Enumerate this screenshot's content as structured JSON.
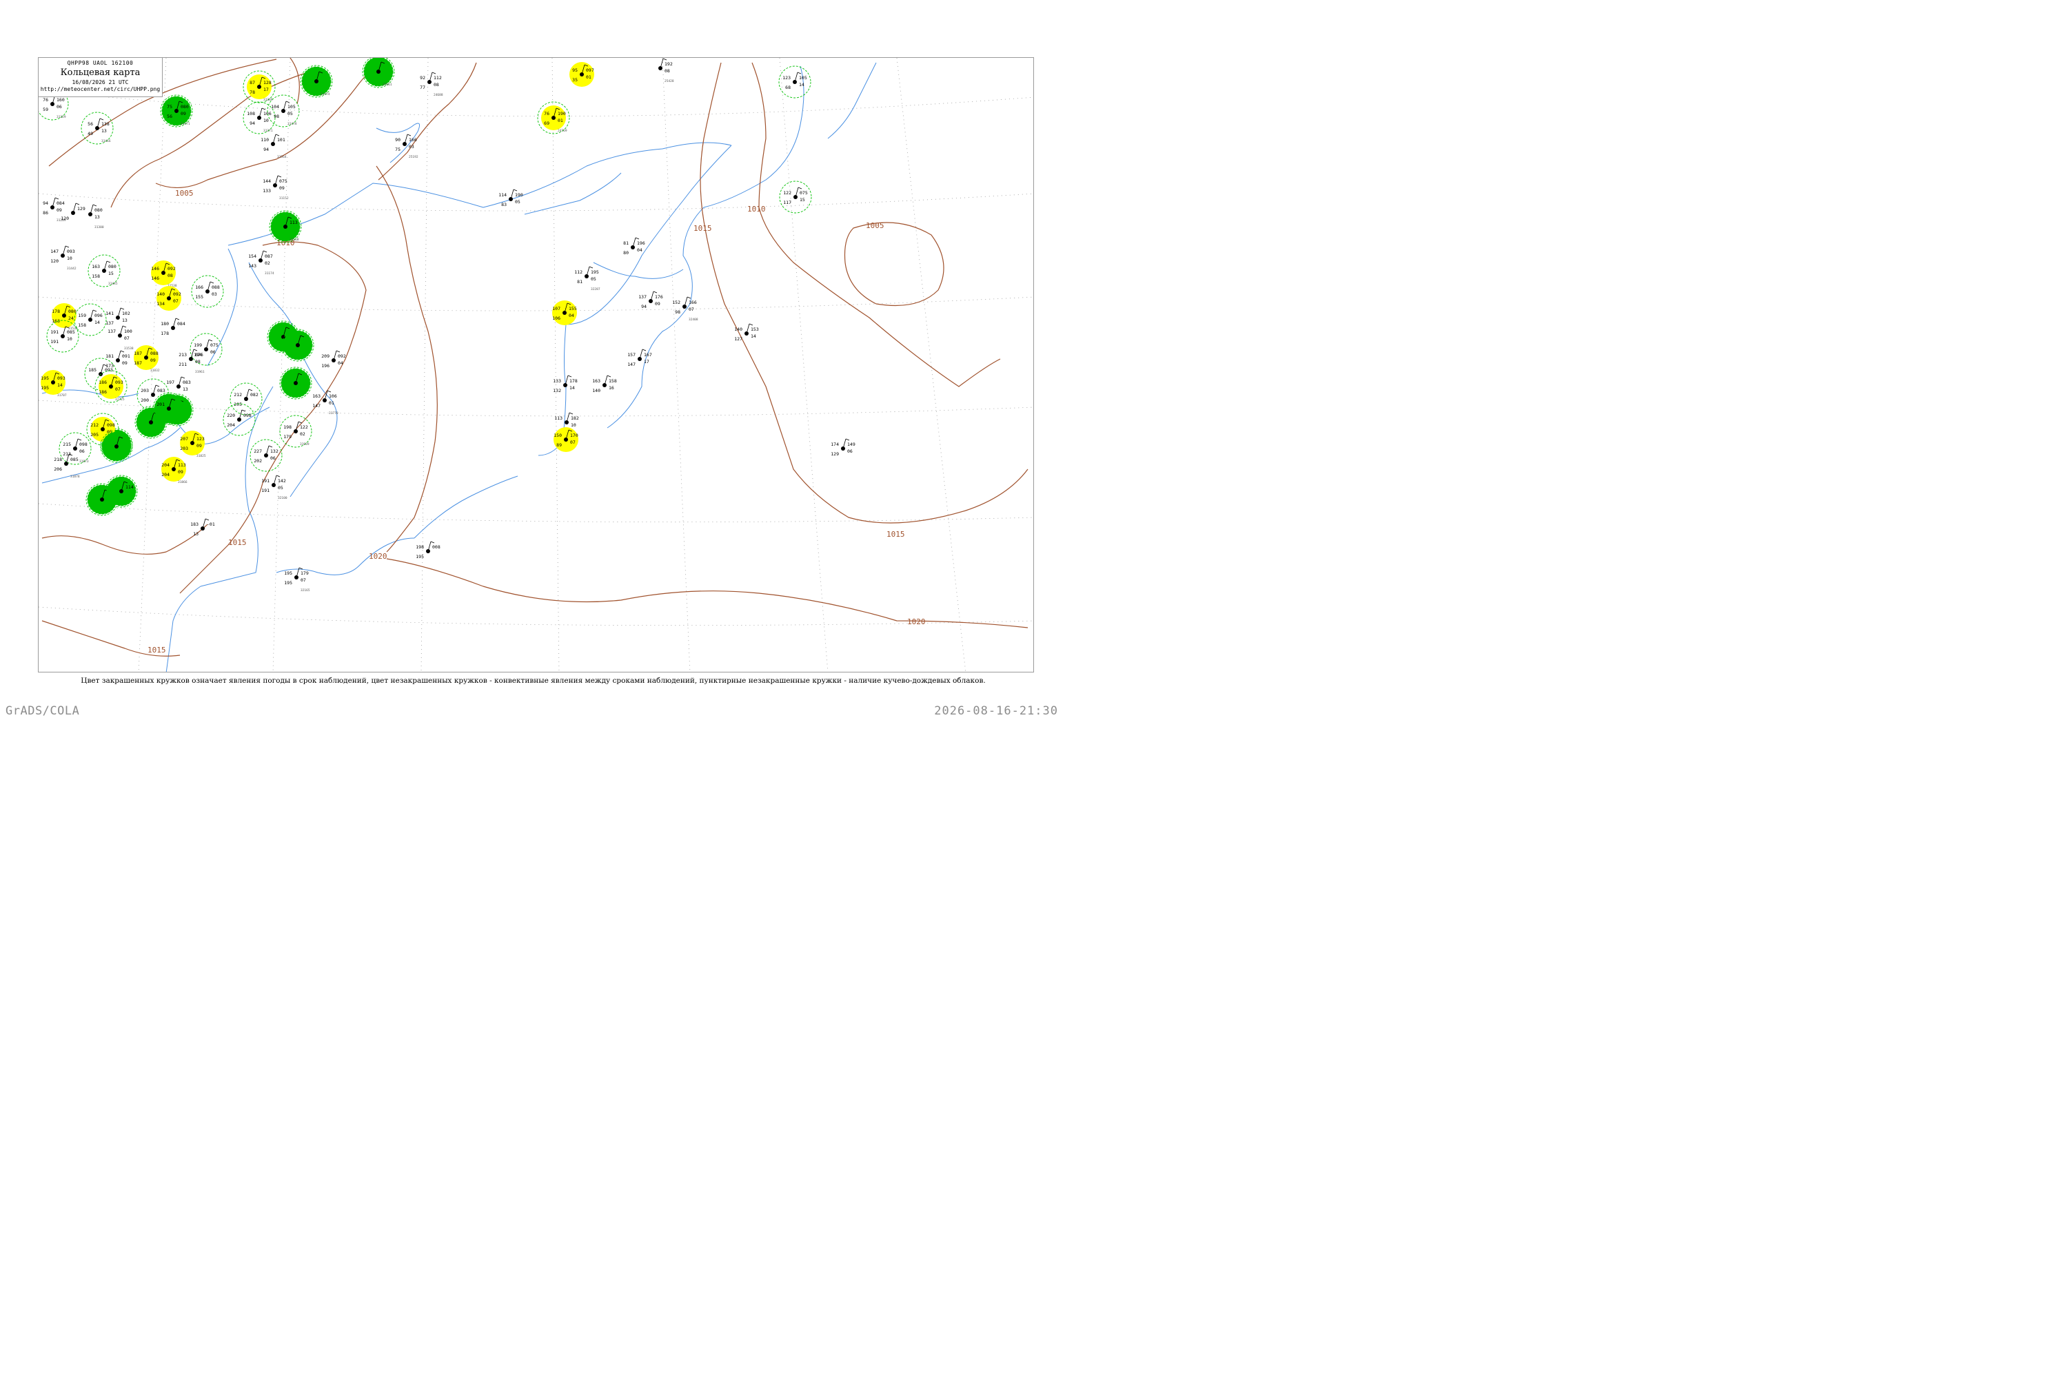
{
  "header": {
    "code_line": "QHPP98  UAOL  162100",
    "title": "Кольцевая карта",
    "datetime": "16/08/2026 21 UTC",
    "url": "http://meteocenter.net/circ/UHPP.png"
  },
  "footnote": "Цвет закрашенных кружков означает явления погоды в срок наблюдений, цвет незакрашенных кружков - конвективные явления между сроками наблюдений, пунктирные незакрашенные кружки - наличие кучево-дождевых облаков.",
  "credit": "GrADS/COLA",
  "timestamp": "2026-08-16-21:30",
  "colors": {
    "isobar": "#a0522d",
    "river": "#4a90e2",
    "shower_fill": "#00c000",
    "fog_fill": "#ffff00",
    "cb_ring": "#00c000",
    "grid": "#9a9a9a"
  },
  "isobar_labels": [
    "1005",
    "1010",
    "1010",
    "1015",
    "1015",
    "1005",
    "1015",
    "1015",
    "1020",
    "1020"
  ],
  "stations": [
    {
      "pressure": "160",
      "temp": "76",
      "dew": "59",
      "tend": "06",
      "id": "31329",
      "weather": "",
      "cb": true
    },
    {
      "pressure": "138",
      "temp": "56",
      "dew": "49",
      "tend": "13",
      "id": "31416",
      "weather": "",
      "cb": true
    },
    {
      "pressure": "128",
      "temp": "87",
      "dew": "78",
      "tend": "17",
      "id": "31369",
      "weather": "fog",
      "cb": true
    },
    {
      "pressure": "106",
      "temp": "108",
      "dew": "94",
      "tend": "10",
      "id": "31371",
      "weather": "",
      "cb": true
    },
    {
      "pressure": "105",
      "temp": "104",
      "dew": "98",
      "tend": "05",
      "id": "31478",
      "weather": "",
      "cb": true
    },
    {
      "pressure": "080",
      "temp": "75",
      "dew": "56",
      "tend": "09",
      "id": "31471",
      "weather": "shower",
      "cb": true
    },
    {
      "pressure": "",
      "temp": "",
      "dew": "",
      "tend": "",
      "id": "31474",
      "weather": "shower",
      "cb": true
    },
    {
      "pressure": "",
      "temp": "",
      "dew": "",
      "tend": "",
      "id": "32061",
      "weather": "shower",
      "cb": true
    },
    {
      "pressure": "112",
      "temp": "92",
      "dew": "77",
      "tend": "08",
      "id": "24688",
      "weather": "",
      "cb": false
    },
    {
      "pressure": "166",
      "temp": "90",
      "dew": "75",
      "tend": "03",
      "id": "25192",
      "weather": "",
      "cb": false
    },
    {
      "pressure": "101",
      "temp": "110",
      "dew": "94",
      "tend": "",
      "id": "31564",
      "weather": "",
      "cb": false
    },
    {
      "pressure": "075",
      "temp": "144",
      "dew": "133",
      "tend": "09",
      "id": "31152",
      "weather": "",
      "cb": false
    },
    {
      "pressure": "113",
      "temp": "",
      "dew": "",
      "tend": "",
      "id": "31168",
      "weather": "shower",
      "cb": true
    },
    {
      "pressure": "084",
      "temp": "94",
      "dew": "86",
      "tend": "09",
      "id": "31209",
      "weather": "",
      "cb": false
    },
    {
      "pressure": "129",
      "temp": "",
      "dew": "120",
      "tend": "",
      "id": "",
      "weather": "",
      "cb": false
    },
    {
      "pressure": "080",
      "temp": "",
      "dew": "",
      "tend": "13",
      "id": "31300",
      "weather": "",
      "cb": false
    },
    {
      "pressure": "093",
      "temp": "147",
      "dew": "120",
      "tend": "10",
      "id": "31442",
      "weather": "",
      "cb": false
    },
    {
      "pressure": "080",
      "temp": "163",
      "dew": "158",
      "tend": "15",
      "id": "31445",
      "weather": "",
      "cb": true
    },
    {
      "pressure": "092",
      "temp": "146",
      "dew": "146",
      "tend": "08",
      "id": "31538",
      "weather": "fog",
      "cb": false
    },
    {
      "pressure": "087",
      "temp": "154",
      "dew": "143",
      "tend": "02",
      "id": "31174",
      "weather": "",
      "cb": false
    },
    {
      "pressure": "088",
      "temp": "166",
      "dew": "155",
      "tend": "03",
      "id": "",
      "weather": "",
      "cb": true
    },
    {
      "pressure": "092",
      "temp": "140",
      "dew": "134",
      "tend": "07",
      "id": "",
      "weather": "fog",
      "cb": false
    },
    {
      "pressure": "080",
      "temp": "178",
      "dew": "163",
      "tend": "24",
      "id": "31532",
      "weather": "fog",
      "cb": false
    },
    {
      "pressure": "096",
      "temp": "159",
      "dew": "158",
      "tend": "14",
      "id": "",
      "weather": "",
      "cb": true
    },
    {
      "pressure": "102",
      "temp": "141",
      "dew": "137",
      "tend": "13",
      "id": "",
      "weather": "",
      "cb": false
    },
    {
      "pressure": "085",
      "temp": "191",
      "dew": "191",
      "tend": "10",
      "id": "",
      "weather": "",
      "cb": true
    },
    {
      "pressure": "100",
      "temp": "137",
      "dew": "",
      "tend": "07",
      "id": "31538",
      "weather": "",
      "cb": false
    },
    {
      "pressure": "084",
      "temp": "180",
      "dew": "178",
      "tend": "",
      "id": "",
      "weather": "",
      "cb": false
    },
    {
      "pressure": "075",
      "temp": "199",
      "dew": "194",
      "tend": "06",
      "id": "",
      "weather": "",
      "cb": true
    },
    {
      "pressure": "088",
      "temp": "187",
      "dew": "187",
      "tend": "09",
      "id": "31832",
      "weather": "fog",
      "cb": false
    },
    {
      "pressure": "091",
      "temp": "181",
      "dew": "173",
      "tend": "09",
      "id": "",
      "weather": "",
      "cb": false
    },
    {
      "pressure": "093",
      "temp": "185",
      "dew": "",
      "tend": "",
      "id": "",
      "weather": "",
      "cb": true
    },
    {
      "pressure": "093",
      "temp": "186",
      "dew": "186",
      "tend": "07",
      "id": "31725",
      "weather": "fog",
      "cb": true
    },
    {
      "pressure": "093",
      "temp": "195",
      "dew": "195",
      "tend": "14",
      "id": "31707",
      "weather": "fog",
      "cb": false
    },
    {
      "pressure": "083",
      "temp": "197",
      "dew": "",
      "tend": "13",
      "id": "",
      "weather": "",
      "cb": false
    },
    {
      "pressure": "083",
      "temp": "203",
      "dew": "200",
      "tend": "",
      "id": "",
      "weather": "",
      "cb": true
    },
    {
      "pressure": "076",
      "temp": "213",
      "dew": "211",
      "tend": "08",
      "id": "31961",
      "weather": "",
      "cb": false
    },
    {
      "pressure": "",
      "temp": "",
      "dew": "",
      "tend": "",
      "id": "",
      "weather": "shower",
      "cb": true
    },
    {
      "pressure": "",
      "temp": "",
      "dew": "",
      "tend": "",
      "id": "",
      "weather": "shower",
      "cb": true
    },
    {
      "pressure": "",
      "temp": "",
      "dew": "",
      "tend": "",
      "id": "",
      "weather": "shower",
      "cb": true
    },
    {
      "pressure": "092",
      "temp": "209",
      "dew": "196",
      "tend": "04",
      "id": "",
      "weather": "",
      "cb": false
    },
    {
      "pressure": "",
      "temp": "",
      "dew": "",
      "tend": "",
      "id": "",
      "weather": "shower",
      "cb": true
    },
    {
      "pressure": "106",
      "temp": "163",
      "dew": "147",
      "tend": "01",
      "id": "31770",
      "weather": "",
      "cb": false
    },
    {
      "pressure": "082",
      "temp": "212",
      "dew": "205",
      "tend": "",
      "id": "",
      "weather": "",
      "cb": true
    },
    {
      "pressure": "098",
      "temp": "220",
      "dew": "204",
      "tend": "",
      "id": "",
      "weather": "",
      "cb": true
    },
    {
      "pressure": "",
      "temp": "201",
      "dew": "",
      "tend": "",
      "id": "",
      "weather": "shower",
      "cb": true
    },
    {
      "pressure": "",
      "temp": "",
      "dew": "",
      "tend": "",
      "id": "",
      "weather": "shower",
      "cb": true
    },
    {
      "pressure": "122",
      "temp": "198",
      "dew": "179",
      "tend": "02",
      "id": "31939",
      "weather": "",
      "cb": true
    },
    {
      "pressure": "098",
      "temp": "212",
      "dew": "205",
      "tend": "05",
      "id": "",
      "weather": "fog",
      "cb": true
    },
    {
      "pressure": "",
      "temp": "",
      "dew": "",
      "tend": "",
      "id": "",
      "weather": "shower",
      "cb": true
    },
    {
      "pressure": "098",
      "temp": "215",
      "dew": "213",
      "tend": "06",
      "id": "31873",
      "weather": "",
      "cb": true
    },
    {
      "pressure": "123",
      "temp": "207",
      "dew": "203",
      "tend": "09",
      "id": "31825",
      "weather": "fog",
      "cb": false
    },
    {
      "pressure": "132",
      "temp": "227",
      "dew": "202",
      "tend": "06",
      "id": "",
      "weather": "",
      "cb": true
    },
    {
      "pressure": "085",
      "temp": "218",
      "dew": "206",
      "tend": "",
      "id": "31878",
      "weather": "",
      "cb": false
    },
    {
      "pressure": "113",
      "temp": "204",
      "dew": "204",
      "tend": "09",
      "id": "31866",
      "weather": "fog",
      "cb": false
    },
    {
      "pressure": "142",
      "temp": "191",
      "dew": "191",
      "tend": "05",
      "id": "32100",
      "weather": "",
      "cb": false
    },
    {
      "pressure": "",
      "temp": "",
      "dew": "",
      "tend": "",
      "id": "",
      "weather": "shower",
      "cb": true
    },
    {
      "pressure": "114",
      "temp": "",
      "dew": "",
      "tend": "",
      "id": "",
      "weather": "shower",
      "cb": true
    },
    {
      "pressure": "-01",
      "temp": "183",
      "dew": "13",
      "tend": "",
      "id": "",
      "weather": "",
      "cb": false
    },
    {
      "pressure": "008",
      "temp": "198",
      "dew": "195",
      "tend": "",
      "id": "",
      "weather": "",
      "cb": false
    },
    {
      "pressure": "179",
      "temp": "195",
      "dew": "195",
      "tend": "07",
      "id": "32165",
      "weather": "",
      "cb": false
    },
    {
      "pressure": "",
      "temp": "",
      "dew": "",
      "tend": "",
      "id": "",
      "weather": "shower",
      "cb": true
    },
    {
      "pressure": "097",
      "temp": "95",
      "dew": "35",
      "tend": "01",
      "id": "",
      "weather": "fog",
      "cb": false
    },
    {
      "pressure": "190",
      "temp": "76",
      "dew": "69",
      "tend": "01",
      "id": "24769",
      "weather": "fog",
      "cb": true
    },
    {
      "pressure": "192",
      "temp": "",
      "dew": "",
      "tend": "08",
      "id": "25428",
      "weather": "",
      "cb": false
    },
    {
      "pressure": "105",
      "temp": "123",
      "dew": "68",
      "tend": "14",
      "id": "",
      "weather": "",
      "cb": true
    },
    {
      "pressure": "190",
      "temp": "114",
      "dew": "83",
      "tend": "05",
      "id": "",
      "weather": "",
      "cb": false
    },
    {
      "pressure": "075",
      "temp": "122",
      "dew": "117",
      "tend": "15",
      "id": "",
      "weather": "",
      "cb": true
    },
    {
      "pressure": "196",
      "temp": "81",
      "dew": "80",
      "tend": "04",
      "id": "",
      "weather": "",
      "cb": false
    },
    {
      "pressure": "195",
      "temp": "112",
      "dew": "81",
      "tend": "05",
      "id": "32287",
      "weather": "",
      "cb": false
    },
    {
      "pressure": "176",
      "temp": "137",
      "dew": "94",
      "tend": "09",
      "id": "",
      "weather": "",
      "cb": false
    },
    {
      "pressure": "166",
      "temp": "152",
      "dew": "98",
      "tend": "07",
      "id": "32408",
      "weather": "",
      "cb": false
    },
    {
      "pressure": "155",
      "temp": "107",
      "dew": "106",
      "tend": "04",
      "id": "",
      "weather": "fog",
      "cb": false
    },
    {
      "pressure": "153",
      "temp": "140",
      "dew": "127",
      "tend": "14",
      "id": "",
      "weather": "",
      "cb": false
    },
    {
      "pressure": "167",
      "temp": "157",
      "dew": "147",
      "tend": "17",
      "id": "",
      "weather": "",
      "cb": false
    },
    {
      "pressure": "178",
      "temp": "133",
      "dew": "132",
      "tend": "14",
      "id": "",
      "weather": "",
      "cb": false
    },
    {
      "pressure": "158",
      "temp": "163",
      "dew": "140",
      "tend": "16",
      "id": "",
      "weather": "",
      "cb": false
    },
    {
      "pressure": "182",
      "temp": "113",
      "dew": "",
      "tend": "10",
      "id": "",
      "weather": "",
      "cb": false
    },
    {
      "pressure": "170",
      "temp": "150",
      "dew": "89",
      "tend": "07",
      "id": "",
      "weather": "fog",
      "cb": false
    },
    {
      "pressure": "149",
      "temp": "174",
      "dew": "129",
      "tend": "06",
      "id": "",
      "weather": "",
      "cb": false
    }
  ]
}
